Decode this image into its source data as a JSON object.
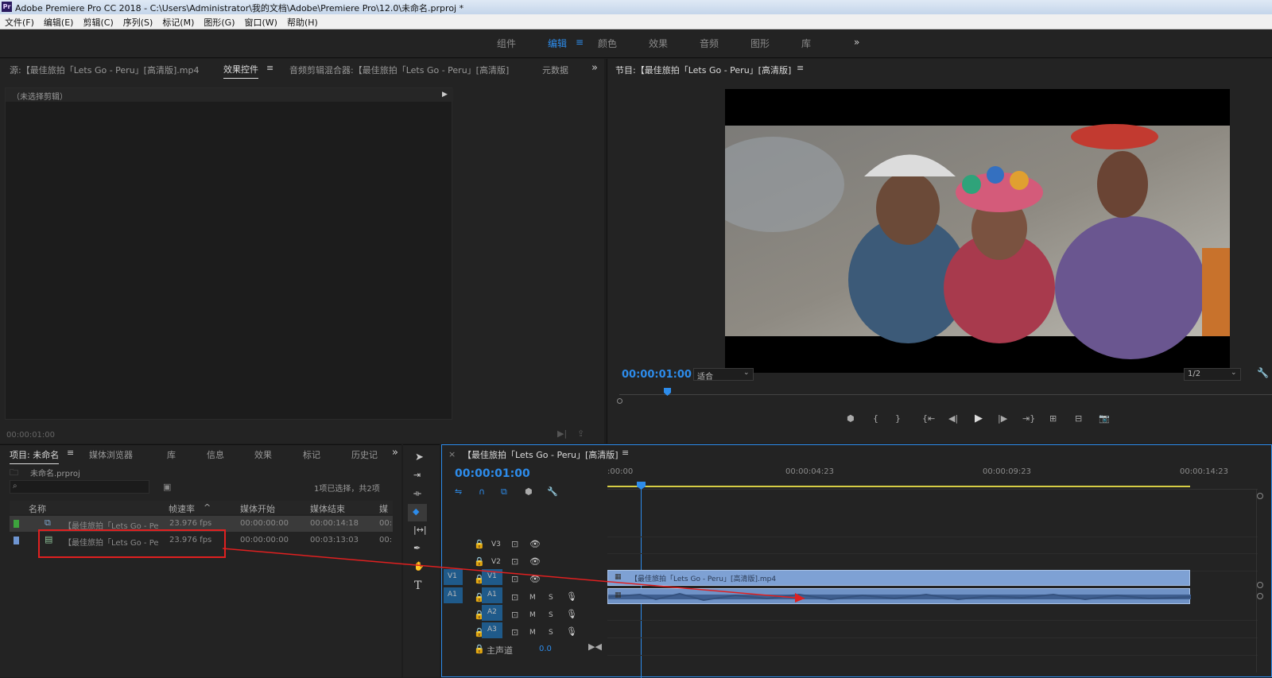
{
  "window": {
    "title": "Adobe Premiere Pro CC 2018 - C:\\Users\\Administrator\\我的文档\\Adobe\\Premiere Pro\\12.0\\未命名.prproj *",
    "app_icon": "Pr"
  },
  "menu": [
    "文件(F)",
    "编辑(E)",
    "剪辑(C)",
    "序列(S)",
    "标记(M)",
    "图形(G)",
    "窗口(W)",
    "帮助(H)"
  ],
  "workspaces": {
    "items": [
      "组件",
      "编辑",
      "颜色",
      "效果",
      "音频",
      "图形",
      "库"
    ],
    "active": "编辑",
    "more": "»"
  },
  "source_panel": {
    "tabs": [
      "源:【最佳旅拍「Lets Go - Peru」[高清版].mp4",
      "效果控件",
      "音频剪辑混合器:【最佳旅拍「Lets Go - Peru」[高清版]",
      "元数据"
    ],
    "no_clip": "（未选择剪辑）",
    "timecode": "00:00:01:00"
  },
  "program_panel": {
    "title": "节目:【最佳旅拍「Lets Go - Peru」[高清版]",
    "timecode": "00:00:01:00",
    "fit": "适合",
    "resolution": "1/2"
  },
  "project_panel": {
    "tabs": [
      "项目: 未命名",
      "媒体浏览器",
      "库",
      "信息",
      "效果",
      "标记",
      "历史记"
    ],
    "file": "未命名.prproj",
    "selection": "1项已选择，共2项",
    "headers": [
      "名称",
      "帧速率",
      "媒体开始",
      "媒体结束",
      "媒体"
    ],
    "rows": [
      {
        "name": "【最佳旅拍「Lets Go - Pe",
        "fps": "23.976 fps",
        "start": "00:00:00:00",
        "end": "00:00:14:18",
        "more": "00:"
      },
      {
        "name": "【最佳旅拍「Lets Go - Pe",
        "fps": "23.976 fps",
        "start": "00:00:00:00",
        "end": "00:03:13:03",
        "more": "00:"
      }
    ]
  },
  "timeline": {
    "title": "【最佳旅拍「Lets Go - Peru」[高清版]",
    "timecode": "00:00:01:00",
    "ruler": [
      ":00:00",
      "00:00:04:23",
      "00:00:09:23",
      "00:00:14:23"
    ],
    "video_tracks": [
      "V3",
      "V2",
      "V1"
    ],
    "audio_tracks": [
      "A1",
      "A2",
      "A3"
    ],
    "src_v": "V1",
    "src_a": "A1",
    "master": "主声道",
    "master_val": "0.0",
    "clip_label": "【最佳旅拍「Lets Go - Peru」[高清版].mp4",
    "m": "M",
    "s": "S"
  }
}
